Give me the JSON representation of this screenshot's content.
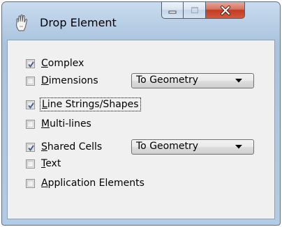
{
  "window": {
    "title": "Drop Element",
    "icon": "drop-element-hand-icon",
    "caption_buttons": [
      "minimize-icon",
      "maximize-icon",
      "close-icon"
    ]
  },
  "options": [
    {
      "pre": "",
      "mnemonic": "C",
      "post": "omplex",
      "checked": true
    },
    {
      "pre": "",
      "mnemonic": "D",
      "post": "imensions",
      "checked": false,
      "dropdown": "To Geometry"
    },
    {
      "pre": "",
      "mnemonic": "L",
      "post": "ine Strings/Shapes",
      "checked": true,
      "focused": true
    },
    {
      "pre": "",
      "mnemonic": "M",
      "post": "ulti-lines",
      "checked": false
    },
    {
      "pre": "",
      "mnemonic": "S",
      "post": "hared Cells",
      "checked": true,
      "dropdown": "To Geometry"
    },
    {
      "pre": "",
      "mnemonic": "T",
      "post": "ext",
      "checked": false
    },
    {
      "pre": "",
      "mnemonic": "A",
      "post": "pplication Elements",
      "checked": false
    }
  ],
  "colors": {
    "check": "#4a5f97",
    "close_button": "#c23a22",
    "frame": "#b9cfe6"
  }
}
